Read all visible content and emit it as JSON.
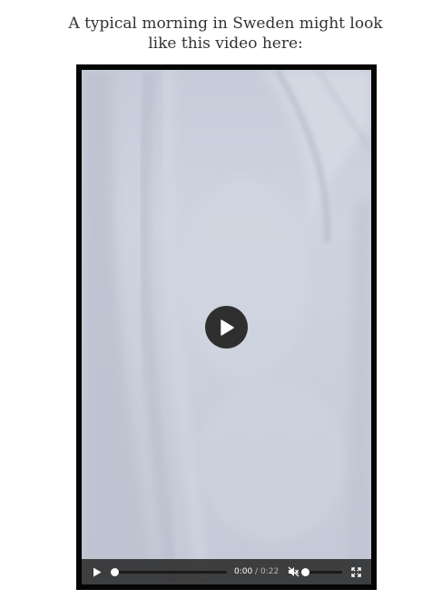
{
  "article": {
    "caption": "A typical morning in Sweden might look like this video here:"
  },
  "video": {
    "play_overlay_icon": "play-icon",
    "controls": {
      "play_icon": "play-icon",
      "progress": 0,
      "current_time": "0:00",
      "separator": "/",
      "duration": "0:22",
      "mute_icon": "volume-muted-icon",
      "volume": 0,
      "fullscreen_icon": "fullscreen-icon"
    }
  },
  "colors": {
    "text": "#333333",
    "frame": "#050505",
    "snow": "#c9cfdb",
    "controls_bg": "#323232",
    "overlay_button": "#2f2f2f"
  }
}
